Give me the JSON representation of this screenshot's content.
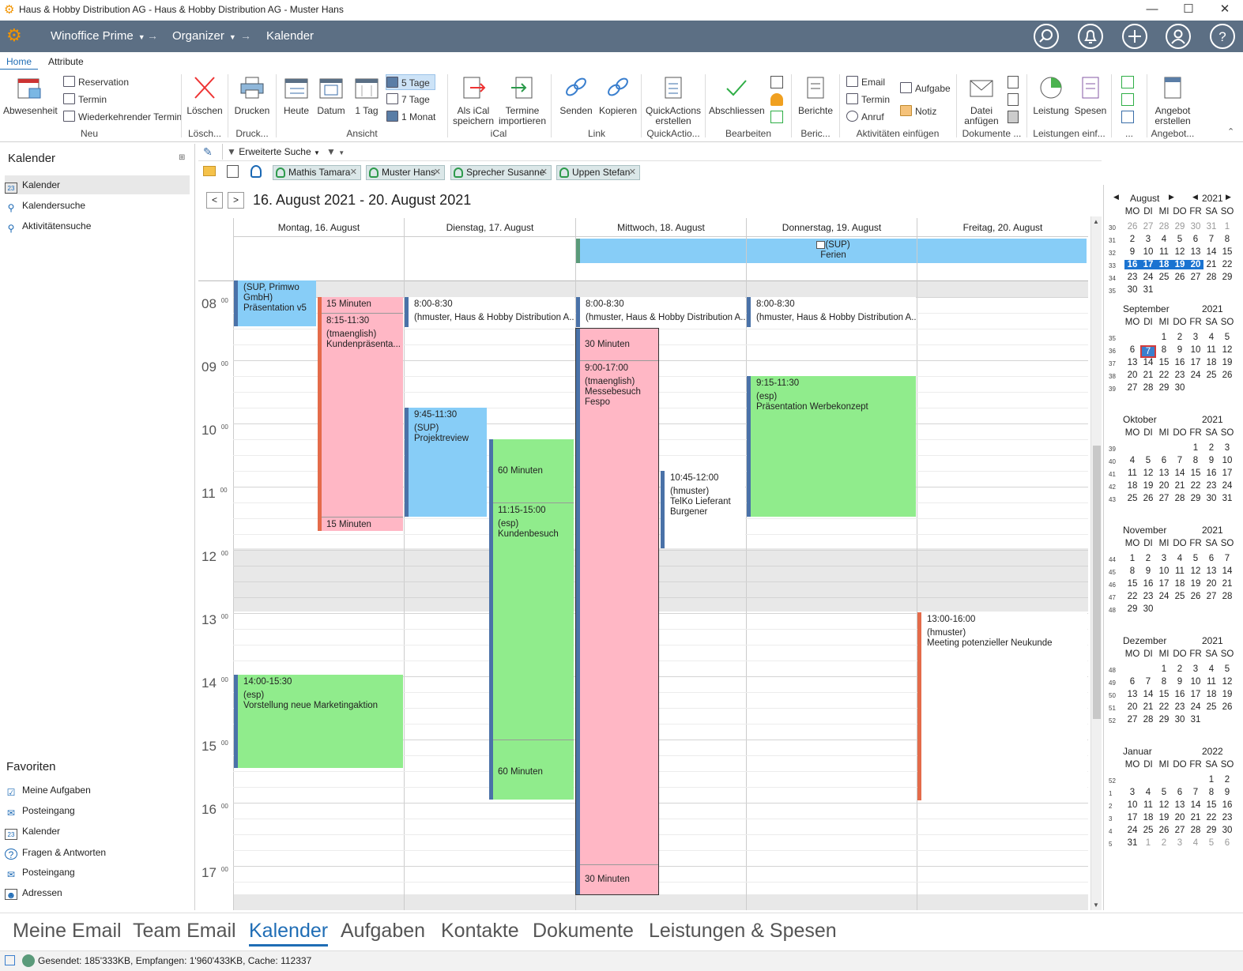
{
  "window": {
    "title": "Haus & Hobby Distribution AG - Haus & Hobby Distribution AG - Muster Hans",
    "min": "—",
    "max": "☐",
    "close": "✕"
  },
  "nav": {
    "app": "Winoffice Prime",
    "module": "Organizer",
    "page": "Kalender"
  },
  "ribbon_tabs": [
    "Home",
    "Attribute"
  ],
  "ribbon": {
    "abwesenheit": "Abwesenheit",
    "reservation": "Reservation",
    "termin": "Termin",
    "wiederkehrend": "Wiederkehrender Termin",
    "g_neu": "Neu",
    "loeschen": "Löschen",
    "g_loesch": "Lösch...",
    "drucken": "Drucken",
    "g_druck": "Druck...",
    "heute": "Heute",
    "datum": "Datum",
    "tag1": "1 Tag",
    "tage5": "5 Tage",
    "tage7": "7 Tage",
    "monat1": "1 Monat",
    "g_ansicht": "Ansicht",
    "ical_save1": "Als iCal",
    "ical_save2": "speichern",
    "ical_imp1": "Termine",
    "ical_imp2": "importieren",
    "g_ical": "iCal",
    "senden": "Senden",
    "kopieren": "Kopieren",
    "g_link": "Link",
    "qa1": "QuickActions",
    "qa2": "erstellen",
    "g_qa": "QuickActio...",
    "abschliessen": "Abschliessen",
    "g_bearb": "Bearbeiten",
    "berichte": "Berichte",
    "g_ber": "Beric...",
    "email": "Email",
    "termin2": "Termin",
    "anruf": "Anruf",
    "aufgabe": "Aufgabe",
    "notiz": "Notiz",
    "g_akt": "Aktivitäten einfügen",
    "datei1": "Datei",
    "datei2": "anfügen",
    "g_dok": "Dokumente ...",
    "leistung": "Leistung",
    "spesen": "Spesen",
    "g_leist": "Leistungen einf...",
    "g_dots": "...",
    "angebot1": "Angebot",
    "angebot2": "erstellen",
    "g_angebot": "Angebot..."
  },
  "left": {
    "title": "Kalender",
    "items": [
      "Kalender",
      "Kalendersuche",
      "Aktivitätensuche"
    ],
    "fav_title": "Favoriten",
    "favorites": [
      "Meine Aufgaben",
      "Posteingang",
      "Kalender",
      "Fragen & Antworten",
      "Posteingang",
      "Adressen"
    ]
  },
  "toolbar": {
    "search": "Erweiterte Suche"
  },
  "resources": [
    "Mathis Tamara",
    "Muster Hans",
    "Sprecher Susanne",
    "Uppen Stefan"
  ],
  "date_range": "16. August 2021 - 20. August 2021",
  "days": [
    "Montag, 16. August",
    "Dienstag, 17. August",
    "Mittwoch, 18. August",
    "Donnerstag, 19. August",
    "Freitag, 20. August"
  ],
  "hours": [
    "08",
    "09",
    "10",
    "11",
    "12",
    "13",
    "14",
    "15",
    "16",
    "17"
  ],
  "minutes": "00",
  "allday_event": {
    "l1": "(SUP)",
    "l2": "Ferien"
  },
  "events": {
    "e1": {
      "l1": "(SUP, Primwo",
      "l2": "GmbH)",
      "l3": "Präsentation v5"
    },
    "e2": {
      "top": "15 Minuten",
      "l1": "8:15-11:30",
      "l2": "(tmaenglish)",
      "l3": "Kundenpräsenta...",
      "bottom": "15 Minuten"
    },
    "e3": {
      "l1": "8:00-8:30",
      "l2": "(hmuster, Haus & Hobby Distribution A..."
    },
    "e4": {
      "l1": "9:45-11:30",
      "l2": "(SUP)",
      "l3": "Projektreview"
    },
    "e5": {
      "top": "60 Minuten",
      "l1": "11:15-15:00",
      "l2": "(esp)",
      "l3": "Kundenbesuch",
      "bottom": "60 Minuten"
    },
    "e6": {
      "l1": "8:00-8:30",
      "l2": "(hmuster, Haus & Hobby Distribution A..."
    },
    "e7": {
      "top": "30 Minuten",
      "l1": "9:00-17:00",
      "l2": "(tmaenglish)",
      "l3": "Messebesuch",
      "l4": "Fespo",
      "bottom": "30 Minuten"
    },
    "e8": {
      "l1": "10:45-12:00",
      "l2": "(hmuster)",
      "l3": "TelKo Lieferant",
      "l4": "Burgener"
    },
    "e9": {
      "l1": "8:00-8:30",
      "l2": "(hmuster, Haus & Hobby Distribution A..."
    },
    "e10": {
      "l1": "9:15-11:30",
      "l2": "(esp)",
      "l3": "Präsentation Werbekonzept"
    },
    "e11": {
      "l1": "13:00-16:00",
      "l2": "(hmuster)",
      "l3": "Meeting potenzieller Neukunde"
    },
    "e12": {
      "l1": "14:00-15:30",
      "l2": "(esp)",
      "l3": "Vorstellung neue Marketingaktion"
    }
  },
  "minical": {
    "weekdays": [
      "MO",
      "DI",
      "MI",
      "DO",
      "FR",
      "SA",
      "SO"
    ],
    "months": [
      {
        "name": "August",
        "year": "2021",
        "weeks": [
          [
            "30",
            "26",
            "27",
            "28",
            "29",
            "30",
            "31",
            "1"
          ],
          [
            "31",
            "2",
            "3",
            "4",
            "5",
            "6",
            "7",
            "8"
          ],
          [
            "32",
            "9",
            "10",
            "11",
            "12",
            "13",
            "14",
            "15"
          ],
          [
            "33",
            "16",
            "17",
            "18",
            "19",
            "20",
            "21",
            "22"
          ],
          [
            "34",
            "23",
            "24",
            "25",
            "26",
            "27",
            "28",
            "29"
          ],
          [
            "35",
            "30",
            "31",
            "",
            "",
            "",
            "",
            ""
          ]
        ]
      },
      {
        "name": "September",
        "year": "2021",
        "weeks": [
          [
            "35",
            "",
            "",
            "1",
            "2",
            "3",
            "4",
            "5"
          ],
          [
            "36",
            "6",
            "7",
            "8",
            "9",
            "10",
            "11",
            "12"
          ],
          [
            "37",
            "13",
            "14",
            "15",
            "16",
            "17",
            "18",
            "19"
          ],
          [
            "38",
            "20",
            "21",
            "22",
            "23",
            "24",
            "25",
            "26"
          ],
          [
            "39",
            "27",
            "28",
            "29",
            "30",
            "",
            "",
            ""
          ]
        ]
      },
      {
        "name": "Oktober",
        "year": "2021",
        "weeks": [
          [
            "39",
            "",
            "",
            "",
            "",
            "1",
            "2",
            "3"
          ],
          [
            "40",
            "4",
            "5",
            "6",
            "7",
            "8",
            "9",
            "10"
          ],
          [
            "41",
            "11",
            "12",
            "13",
            "14",
            "15",
            "16",
            "17"
          ],
          [
            "42",
            "18",
            "19",
            "20",
            "21",
            "22",
            "23",
            "24"
          ],
          [
            "43",
            "25",
            "26",
            "27",
            "28",
            "29",
            "30",
            "31"
          ]
        ]
      },
      {
        "name": "November",
        "year": "2021",
        "weeks": [
          [
            "44",
            "1",
            "2",
            "3",
            "4",
            "5",
            "6",
            "7"
          ],
          [
            "45",
            "8",
            "9",
            "10",
            "11",
            "12",
            "13",
            "14"
          ],
          [
            "46",
            "15",
            "16",
            "17",
            "18",
            "19",
            "20",
            "21"
          ],
          [
            "47",
            "22",
            "23",
            "24",
            "25",
            "26",
            "27",
            "28"
          ],
          [
            "48",
            "29",
            "30",
            "",
            "",
            "",
            "",
            ""
          ]
        ]
      },
      {
        "name": "Dezember",
        "year": "2021",
        "weeks": [
          [
            "48",
            "",
            "",
            "1",
            "2",
            "3",
            "4",
            "5"
          ],
          [
            "49",
            "6",
            "7",
            "8",
            "9",
            "10",
            "11",
            "12"
          ],
          [
            "50",
            "13",
            "14",
            "15",
            "16",
            "17",
            "18",
            "19"
          ],
          [
            "51",
            "20",
            "21",
            "22",
            "23",
            "24",
            "25",
            "26"
          ],
          [
            "52",
            "27",
            "28",
            "29",
            "30",
            "31",
            "",
            ""
          ]
        ]
      },
      {
        "name": "Januar",
        "year": "2022",
        "weeks": [
          [
            "52",
            "",
            "",
            "",
            "",
            "",
            "1",
            "2"
          ],
          [
            "1",
            "3",
            "4",
            "5",
            "6",
            "7",
            "8",
            "9"
          ],
          [
            "2",
            "10",
            "11",
            "12",
            "13",
            "14",
            "15",
            "16"
          ],
          [
            "3",
            "17",
            "18",
            "19",
            "20",
            "21",
            "22",
            "23"
          ],
          [
            "4",
            "24",
            "25",
            "26",
            "27",
            "28",
            "29",
            "30"
          ],
          [
            "5",
            "31",
            "1",
            "2",
            "3",
            "4",
            "5",
            "6"
          ]
        ]
      }
    ]
  },
  "bottom_nav": [
    "Meine Email",
    "Team Email",
    "Kalender",
    "Aufgaben",
    "Kontakte",
    "Dokumente",
    "Leistungen & Spesen"
  ],
  "status": "Gesendet: 185'333KB, Empfangen: 1'960'433KB, Cache: 112337",
  "colors": {
    "nav_bg": "#5c6f84",
    "accent": "#1f6db5",
    "event_blue": "#87cdf7",
    "event_green": "#90ec8c",
    "event_pink": "#ffb7c5",
    "logo": "#f29400"
  }
}
